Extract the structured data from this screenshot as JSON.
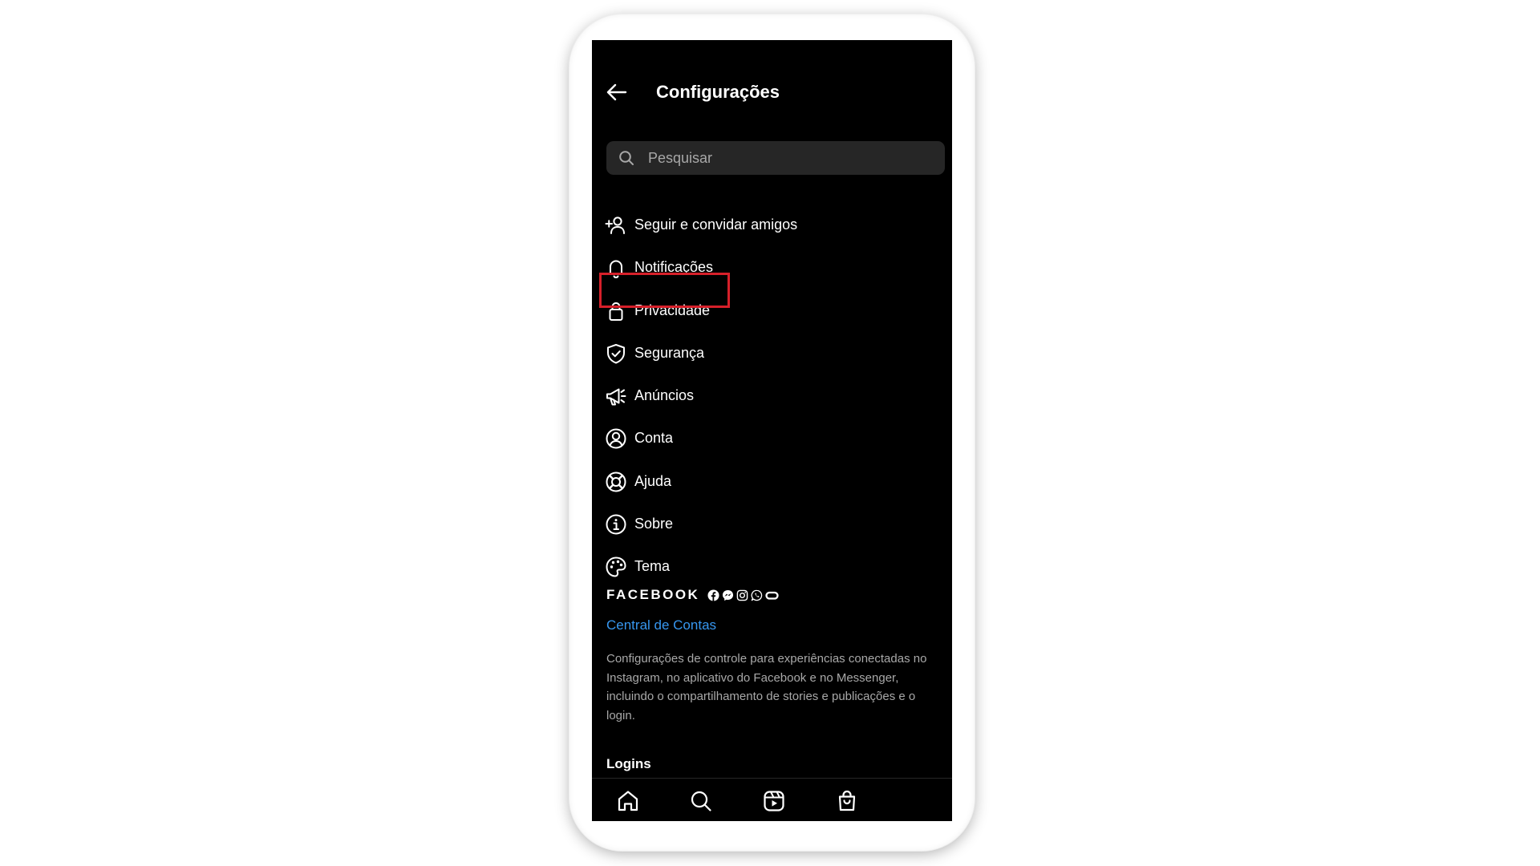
{
  "header": {
    "title": "Configurações",
    "back_icon": "arrow-left-icon"
  },
  "search": {
    "placeholder": "Pesquisar",
    "value": "",
    "icon": "search-icon"
  },
  "menu": [
    {
      "label": "Seguir e convidar amigos",
      "icon": "add-person-icon"
    },
    {
      "label": "Notificações",
      "icon": "bell-icon"
    },
    {
      "label": "Privacidade",
      "icon": "lock-icon",
      "highlighted": true
    },
    {
      "label": "Segurança",
      "icon": "shield-check-icon"
    },
    {
      "label": "Anúncios",
      "icon": "megaphone-icon"
    },
    {
      "label": "Conta",
      "icon": "user-circle-icon"
    },
    {
      "label": "Ajuda",
      "icon": "lifebuoy-icon"
    },
    {
      "label": "Sobre",
      "icon": "info-icon"
    },
    {
      "label": "Tema",
      "icon": "palette-icon"
    }
  ],
  "facebook_section": {
    "brand": "FACEBOOK",
    "app_icons": [
      "facebook-icon",
      "messenger-icon",
      "instagram-icon",
      "whatsapp-icon",
      "portal-icon"
    ],
    "accounts_center_link": "Central de Contas",
    "description": "Configurações de controle para experiências conectadas no Instagram, no aplicativo do Facebook e no Messenger, incluindo o compartilhamento de stories e publicações e o login."
  },
  "logins_heading": "Logins",
  "bottom_nav": [
    "home-icon",
    "search-icon",
    "reels-icon",
    "shop-bag-icon"
  ],
  "colors": {
    "screen_bg": "#000000",
    "search_bg": "#262626",
    "link": "#3797f0",
    "muted_text": "#a8a8a8",
    "highlight_border": "#d6202a"
  }
}
